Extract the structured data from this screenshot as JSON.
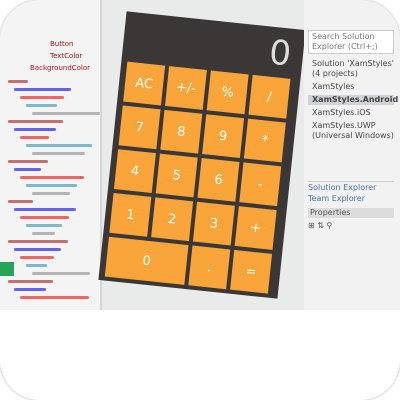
{
  "calculator": {
    "display": "0",
    "keys": [
      "AC",
      "+/-",
      "%",
      "/",
      "7",
      "8",
      "9",
      "*",
      "4",
      "5",
      "6",
      "-",
      "1",
      "2",
      "3",
      "+",
      "0",
      ".",
      "="
    ],
    "button_color": "#f9a53a",
    "body_color": "#3a3736"
  },
  "solution_explorer": {
    "search_placeholder": "Search Solution Explorer (Ctrl+;)",
    "items": [
      "Solution 'XamStyles' (4 projects)",
      "XamStyles",
      "XamStyles.Android",
      "XamStyles.iOS",
      "XamStyles.UWP (Universal Windows)"
    ],
    "selected_index": 2,
    "tabs": [
      "Solution Explorer",
      "Team Explorer"
    ],
    "properties_label": "Properties"
  },
  "code_snippets": [
    "Button",
    "TextColor",
    "BackgroundColor"
  ]
}
